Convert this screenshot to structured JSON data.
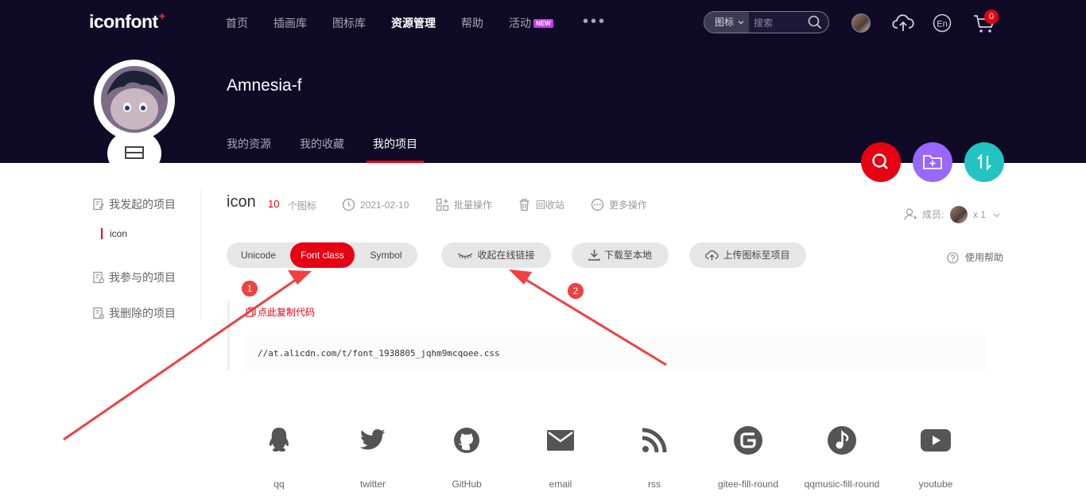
{
  "header": {
    "logo": "iconfont",
    "logo_mark": "+",
    "nav": [
      {
        "label": "首页"
      },
      {
        "label": "插画库"
      },
      {
        "label": "图标库"
      },
      {
        "label": "资源管理",
        "active": true
      },
      {
        "label": "帮助"
      },
      {
        "label": "活动",
        "badge": "NEW"
      }
    ],
    "more": "•••",
    "search": {
      "type": "图标",
      "placeholder": "搜索"
    },
    "cart_count": "0",
    "lang": "En"
  },
  "profile": {
    "name": "Amnesia-f",
    "tabs": [
      {
        "label": "我的资源"
      },
      {
        "label": "我的收藏"
      },
      {
        "label": "我的项目",
        "active": true
      }
    ]
  },
  "fabs": [
    {
      "icon": "search-icon",
      "color": "#e60012"
    },
    {
      "icon": "folder-add-icon",
      "color": "#9966ff"
    },
    {
      "icon": "sort-icon",
      "color": "#24c3c3"
    }
  ],
  "sidebar": {
    "initiated": "我发起的项目",
    "project": "icon",
    "joined": "我参与的项目",
    "deleted": "我删除的项目"
  },
  "project": {
    "name": "icon",
    "count": "10",
    "count_unit": "个图标",
    "date": "2021-02-10",
    "batch": "批量操作",
    "recycle": "回收站",
    "more": "更多操作",
    "members_label": "成员:",
    "members_count": "x 1"
  },
  "toolbar": {
    "tabs": [
      {
        "label": "Unicode"
      },
      {
        "label": "Font class",
        "active": true
      },
      {
        "label": "Symbol"
      }
    ],
    "collapse": "收起在线链接",
    "download": "下载至本地",
    "upload": "上传图标至项目",
    "help": "使用帮助"
  },
  "code": {
    "copy": "点此复制代码",
    "url": "//at.alicdn.com/t/font_1938805_jqhm9mcqoee.css"
  },
  "icons": [
    {
      "name": "qq"
    },
    {
      "name": "twitter"
    },
    {
      "name": "GitHub"
    },
    {
      "name": "email"
    },
    {
      "name": "rss"
    },
    {
      "name": "gitee-fill-round"
    },
    {
      "name": "qqmusic-fill-round"
    },
    {
      "name": "youtube"
    }
  ],
  "annotations": {
    "marker1": "1",
    "marker2": "2"
  },
  "colors": {
    "accent": "#e60012",
    "header_bg": "#0f0a26",
    "arrow": "#f04040"
  }
}
